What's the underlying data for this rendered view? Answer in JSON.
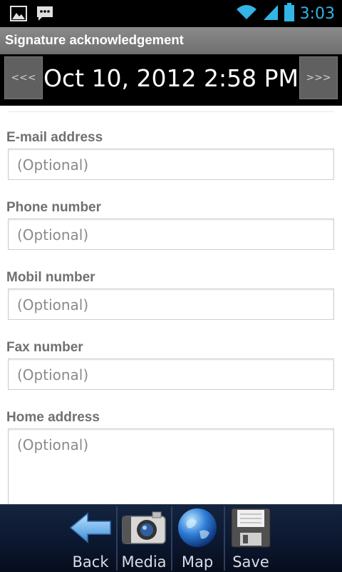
{
  "status_bar": {
    "time": "3:03"
  },
  "title_bar": {
    "title": "Signature acknowledgement"
  },
  "date_bar": {
    "prev_label": "<<<",
    "datetime": "Oct 10, 2012 2:58 PM",
    "next_label": ">>>"
  },
  "form": {
    "fields": [
      {
        "label": "E-mail address",
        "placeholder": "(Optional)"
      },
      {
        "label": "Phone number",
        "placeholder": "(Optional)"
      },
      {
        "label": "Mobil number",
        "placeholder": "(Optional)"
      },
      {
        "label": "Fax number",
        "placeholder": "(Optional)"
      },
      {
        "label": "Home address",
        "placeholder": "(Optional)"
      }
    ]
  },
  "toolbar": {
    "buttons": [
      {
        "label": "Back",
        "icon": "back-arrow-icon"
      },
      {
        "label": "Media",
        "icon": "camera-icon"
      },
      {
        "label": "Map",
        "icon": "globe-icon"
      },
      {
        "label": "Save",
        "icon": "floppy-disk-icon"
      }
    ]
  },
  "colors": {
    "clock": "#33b5e5",
    "title_bar": "#7d7d7d",
    "toolbar_bg": "#0c1830"
  }
}
